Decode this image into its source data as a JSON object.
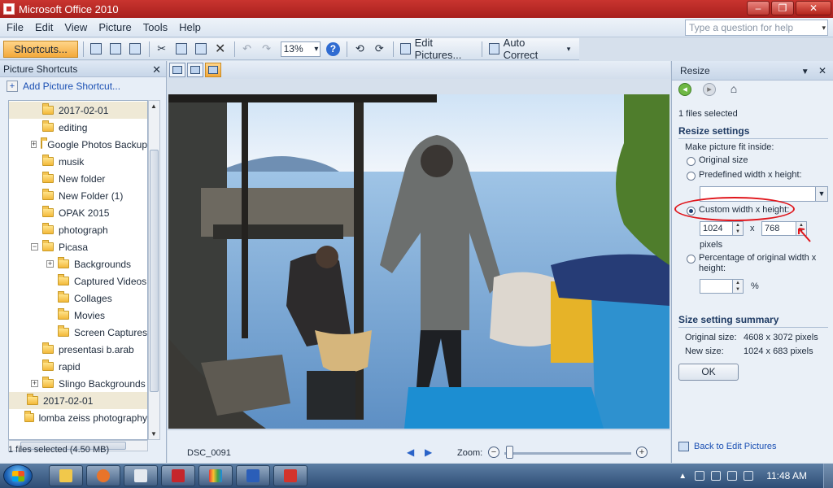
{
  "window": {
    "title": "Microsoft Office 2010"
  },
  "menu": [
    "File",
    "Edit",
    "View",
    "Picture",
    "Tools",
    "Help"
  ],
  "help_box": {
    "placeholder": "Type a question for help"
  },
  "toolbar": {
    "shortcuts_label": "Shortcuts...",
    "zoom_value": "13%",
    "edit_pictures_label": "Edit Pictures...",
    "auto_correct_label": "Auto Correct"
  },
  "left_panel": {
    "title": "Picture Shortcuts",
    "add_label": "Add Picture Shortcut...",
    "items": [
      {
        "label": "2017-02-01",
        "indent": 1,
        "expander": "",
        "selected": true
      },
      {
        "label": "editing",
        "indent": 1,
        "expander": ""
      },
      {
        "label": "Google Photos Backup",
        "indent": 1,
        "expander": "+"
      },
      {
        "label": "musik",
        "indent": 1,
        "expander": ""
      },
      {
        "label": "New folder",
        "indent": 1,
        "expander": ""
      },
      {
        "label": "New Folder (1)",
        "indent": 1,
        "expander": ""
      },
      {
        "label": "OPAK 2015",
        "indent": 1,
        "expander": ""
      },
      {
        "label": "photograph",
        "indent": 1,
        "expander": ""
      },
      {
        "label": "Picasa",
        "indent": 1,
        "expander": "-"
      },
      {
        "label": "Backgrounds",
        "indent": 2,
        "expander": "+"
      },
      {
        "label": "Captured Videos",
        "indent": 2,
        "expander": ""
      },
      {
        "label": "Collages",
        "indent": 2,
        "expander": ""
      },
      {
        "label": "Movies",
        "indent": 2,
        "expander": ""
      },
      {
        "label": "Screen Captures",
        "indent": 2,
        "expander": ""
      },
      {
        "label": "presentasi b.arab",
        "indent": 1,
        "expander": ""
      },
      {
        "label": "rapid",
        "indent": 1,
        "expander": ""
      },
      {
        "label": "Slingo Backgrounds",
        "indent": 1,
        "expander": "+"
      },
      {
        "label": "2017-02-01",
        "indent": 0,
        "expander": "",
        "selected": true
      },
      {
        "label": "lomba zeiss photography",
        "indent": 0,
        "expander": ""
      }
    ],
    "status": "1 files selected (4.50 MB)"
  },
  "center": {
    "filename": "DSC_0091",
    "zoom_label": "Zoom:"
  },
  "resize_panel": {
    "title": "Resize",
    "files_selected": "1 files selected",
    "settings_heading": "Resize settings",
    "fit_inside_label": "Make picture fit inside:",
    "option_original": "Original size",
    "option_predefined": "Predefined width x height:",
    "option_custom": "Custom width x height:",
    "width_value": "1024",
    "x_separator": "x",
    "height_value": "768",
    "pixels_label": "pixels",
    "option_percentage": "Percentage of original width x height:",
    "percent_symbol": "%",
    "summary_heading": "Size setting summary",
    "original_size_label": "Original size:",
    "original_size_value": "4608 x 3072 pixels",
    "new_size_label": "New size:",
    "new_size_value": "1024 x 683 pixels",
    "ok_label": "OK",
    "back_link": "Back to Edit Pictures"
  },
  "taskbar": {
    "clock": "11:48 AM"
  },
  "colors": {
    "title_bar": "#c9342f",
    "highlight": "#e0161c",
    "accent_orange": "#f3a93b"
  }
}
